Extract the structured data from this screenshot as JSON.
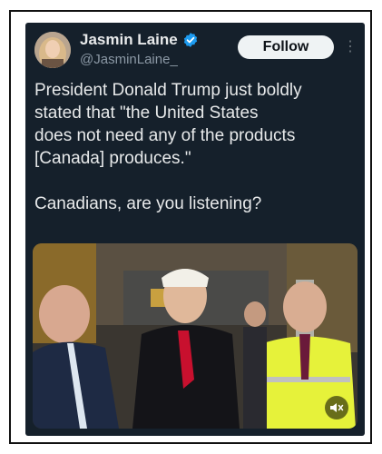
{
  "tweet": {
    "author_name": "Jasmin Laine",
    "handle": "@JasminLaine_",
    "follow_label": "Follow",
    "more_glyph": "⋮",
    "text": "President Donald Trump just boldly\nstated that \"the United States\ndoes not need any of the products\n[Canada] produces.\"\n\nCanadians, are you listening?",
    "verified_icon": "verified-badge-icon",
    "verified_color": "#1d9bf0",
    "media": {
      "type": "video",
      "mute_icon": "speaker-muted-icon"
    }
  },
  "colors": {
    "card_background": "#15202b",
    "primary_text": "#e7e9ea",
    "secondary_text": "#8b98a5",
    "follow_bg": "#eff3f4"
  }
}
